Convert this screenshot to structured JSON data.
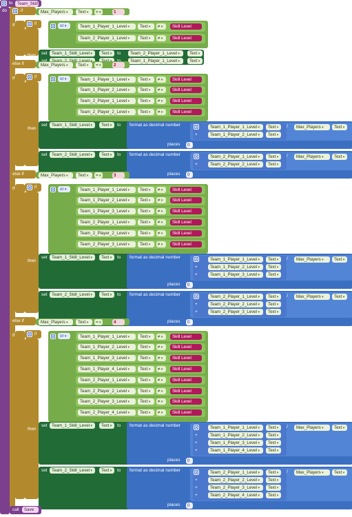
{
  "procedure": {
    "to_label": "to",
    "name": "Team_Skill",
    "do_label": "do",
    "call_label": "call",
    "call_name": "Save"
  },
  "keywords": {
    "if": "if",
    "then": "then",
    "else_if": "else if",
    "or": "or",
    "set": "set",
    "to": "to",
    "format": "format as decimal number",
    "places": "places",
    "places_value": "0",
    "plus": "+",
    "divide": "/",
    "text": "Text",
    "eq": "=",
    "neq": "≠",
    "skill_level": "Skill Level",
    "max_players": "Max_Players"
  },
  "branches": [
    {
      "value": "1",
      "players": [
        "Team_1_Player_1_Level",
        "Team_2_Player_1_Level"
      ],
      "swap": true
    },
    {
      "value": "2",
      "players": [
        "Team_1_Player_1_Level",
        "Team_1_Player_2_Level",
        "Team_2_Player_1_Level",
        "Team_2_Player_2_Level"
      ],
      "team1": [
        "Team_1_Player_1_Level",
        "Team_1_Player_2_Level"
      ],
      "team2": [
        "Team_2_Player_1_Level",
        "Team_2_Player_2_Level"
      ]
    },
    {
      "value": "3",
      "players": [
        "Team_1_Player_1_Level",
        "Team_1_Player_2_Level",
        "Team_1_Player_3_Level",
        "Team_2_Player_1_Level",
        "Team_2_Player_2_Level",
        "Team_2_Player_3_Level"
      ],
      "team1": [
        "Team_1_Player_1_Level",
        "Team_1_Player_2_Level",
        "Team_1_Player_3_Level"
      ],
      "team2": [
        "Team_2_Player_1_Level",
        "Team_2_Player_2_Level",
        "Team_2_Player_3_Level"
      ]
    },
    {
      "value": "4",
      "players": [
        "Team_1_Player_1_Level",
        "Team_1_Player_2_Level",
        "Team_1_Player_3_Level",
        "Team_1_Player_4_Level",
        "Team_2_Player_1_Level",
        "Team_2_Player_2_Level",
        "Team_2_Player_3_Level",
        "Team_2_Player_4_Level"
      ],
      "team1": [
        "Team_1_Player_1_Level",
        "Team_1_Player_2_Level",
        "Team_1_Player_3_Level",
        "Team_1_Player_4_Level"
      ],
      "team2": [
        "Team_2_Player_1_Level",
        "Team_2_Player_2_Level",
        "Team_2_Player_3_Level",
        "Team_2_Player_4_Level"
      ]
    }
  ],
  "set_targets": {
    "team1": "Team_1_Skill_Level",
    "team2": "Team_2_Skill_Level"
  },
  "colors": {
    "procedure": "#7c3f8e",
    "control": "#b28a2d",
    "logic": "#77ac4a",
    "variables": "#216b37",
    "math": "#3b6fc2",
    "text": "#b0195a"
  }
}
